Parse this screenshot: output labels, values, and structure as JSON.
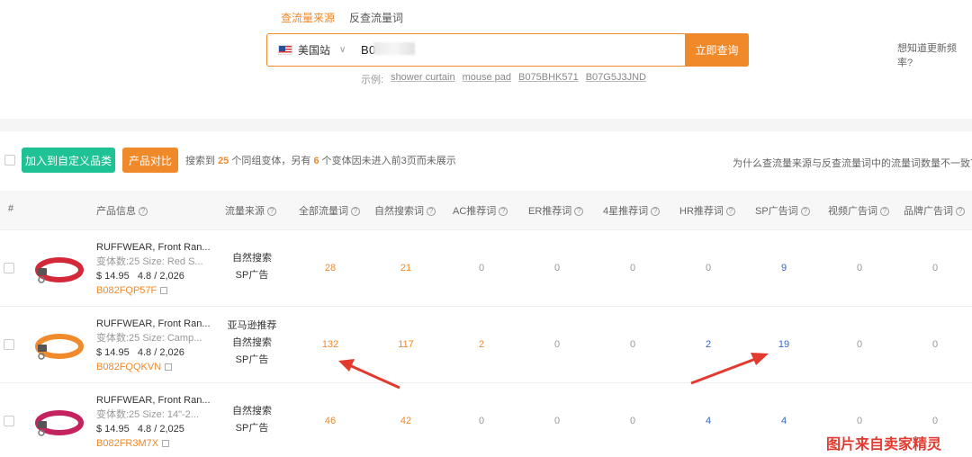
{
  "tabs": [
    {
      "label": "查流量来源",
      "active": true
    },
    {
      "label": "反查流量词",
      "active": false
    }
  ],
  "search": {
    "site_label": "美国站",
    "value": "B0       7F",
    "button_label": "立即查询",
    "examples_label": "示例:",
    "examples": [
      "shower curtain",
      "mouse pad",
      "B075BHK571",
      "B07G5J3JND"
    ]
  },
  "freq_link": "想知道更新频率?",
  "toolbar": {
    "add_button": "加入到自定义品类",
    "compare_button": "产品对比",
    "summary_prefix": "搜索到",
    "summary_count1": "25",
    "summary_mid": "个同组变体，另有",
    "summary_count2": "6",
    "summary_suffix": "个变体因未进入前3页而未展示",
    "why_link": "为什么查流量来源与反查流量词中的流量词数量不一致？"
  },
  "columns": {
    "index": "#",
    "product": "产品信息",
    "source": "流量来源",
    "all": "全部流量词",
    "organic": "自然搜索词",
    "ac": "AC推荐词",
    "er": "ER推荐词",
    "four_star": "4星推荐词",
    "hr": "HR推荐词",
    "sp": "SP广告词",
    "video": "视频广告词",
    "brand": "品牌广告词"
  },
  "rows": [
    {
      "name": "RUFFWEAR, Front Ran...",
      "meta": "变体数:25    Size: Red S...",
      "price": "$ 14.95",
      "rating": "4.8 / 2,026",
      "asin": "B082FQP57F",
      "sources": [
        "自然搜索",
        "SP广告"
      ],
      "all": "28",
      "organic": "21",
      "ac": "0",
      "er": "0",
      "four_star": "0",
      "hr": "0",
      "sp": "9",
      "video": "0",
      "brand": "0",
      "collar_color": "#d2283a"
    },
    {
      "name": "RUFFWEAR, Front Ran...",
      "meta": "变体数:25    Size: Camp...",
      "price": "$ 14.95",
      "rating": "4.8 / 2,026",
      "asin": "B082FQQKVN",
      "sources": [
        "亚马逊推荐",
        "自然搜索",
        "SP广告"
      ],
      "all": "132",
      "organic": "117",
      "ac": "2",
      "er": "0",
      "four_star": "0",
      "hr": "2",
      "sp": "19",
      "video": "0",
      "brand": "0",
      "collar_color": "#f08a2a"
    },
    {
      "name": "RUFFWEAR, Front Ran...",
      "meta": "变体数:25    Size: 14\"-2...",
      "price": "$ 14.95",
      "rating": "4.8 / 2,025",
      "asin": "B082FR3M7X",
      "sources": [
        "自然搜索",
        "SP广告"
      ],
      "all": "46",
      "organic": "42",
      "ac": "0",
      "er": "0",
      "four_star": "0",
      "hr": "4",
      "sp": "4",
      "video": "0",
      "brand": "0",
      "collar_color": "#c4235f"
    }
  ],
  "watermark": "图片来自卖家精灵",
  "colors": {
    "accent": "#f0892a",
    "green": "#1ec294",
    "blue": "#3366cc",
    "arrow": "#e23a2e"
  }
}
